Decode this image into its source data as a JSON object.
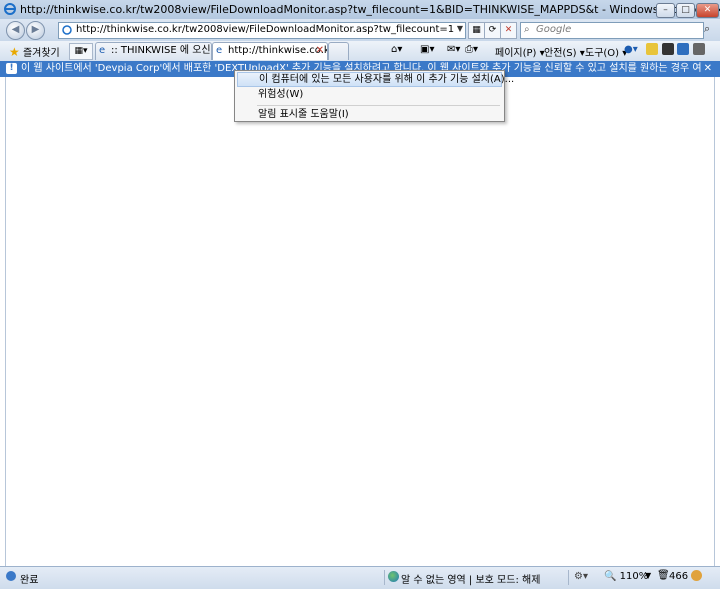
{
  "window": {
    "title": "http://thinkwise.co.kr/tw2008view/FileDownloadMonitor.asp?tw_filecount=1&BID=THINKWISE_MAPPDS&t - Windows Internet Explorer",
    "minimize": "0",
    "maximize": "1",
    "close": "r"
  },
  "nav": {
    "back": "◀",
    "forward": "▶",
    "address": "http://thinkwise.co.kr/tw2008view/FileDownloadMonitor.asp?tw_filecount=1&BID=THINKWISE_MAPPDS&t",
    "search_placeholder": "Google",
    "search_go": "⌕",
    "refresh": "⟳",
    "stop": "✕",
    "compat": "▦"
  },
  "toolbar": {
    "favorites": "즐겨찾기",
    "tabs": [
      {
        "label": ":: THINKWISE 에 오신것을..."
      },
      {
        "label": "http://thinkwise.co.kr/t..."
      }
    ],
    "commands": {
      "page": "페이지(P)",
      "safety": "안전(S)",
      "tools": "도구(O)"
    }
  },
  "infobar": {
    "text": "이 웹 사이트에서 'Devpia Corp'에서 배포한 'DEXTUploadX' 추가 기능을 설치하려고 합니다. 이 웹 사이트와 추가 기능을 신뢰할 수 있고 설치를 원하는 경우 여기를 클릭하십시오.",
    "close": "✕"
  },
  "context_menu": {
    "items": [
      {
        "label": "이 컴퓨터에 있는 모든 사용자를 위해 이 추가 기능 설치(A)..."
      },
      {
        "label": "위험성(W)"
      },
      {
        "label": "알림 표시줄 도움말(I)"
      }
    ]
  },
  "status": {
    "done": "완료",
    "zone": "알 수 없는 영역 | 보호 모드: 해제",
    "zoom": "110%",
    "count": "466"
  },
  "colors": {
    "infobar": "#3b79c8",
    "titlebar": "#c7d7ea"
  }
}
